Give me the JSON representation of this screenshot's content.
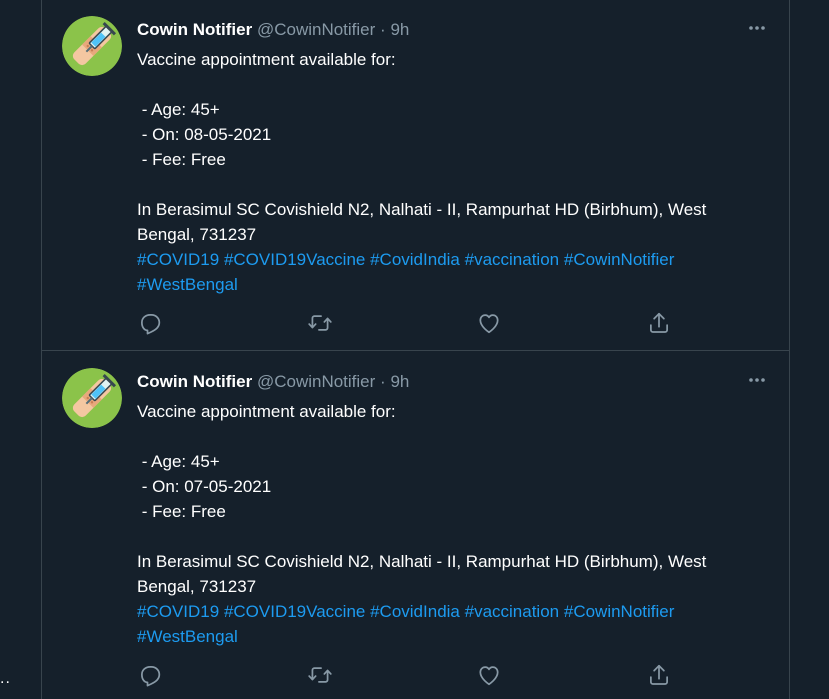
{
  "left_fragment": "..",
  "tweets": [
    {
      "name": "Cowin Notifier",
      "handle": "@CowinNotifier",
      "separator": "·",
      "time": "9h",
      "body": {
        "line1": "Vaccine appointment available for:",
        "line2": " - Age: 45+",
        "line3": " - On: 08-05-2021",
        "line4": " - Fee: Free",
        "line5": "In Berasimul SC Covishield N2, Nalhati - II, Rampurhat HD (Birbhum), West",
        "line6": "Bengal, 731237"
      },
      "hashtags": [
        "#COVID19",
        "#COVID19Vaccine",
        "#CovidIndia",
        "#vaccination",
        "#CowinNotifier",
        "#WestBengal"
      ],
      "icons": {
        "avatar": "syringe-bandage-avatar",
        "more": "more-options-icon",
        "reply": "reply-icon",
        "retweet": "retweet-icon",
        "like": "like-icon",
        "share": "share-icon"
      }
    },
    {
      "name": "Cowin Notifier",
      "handle": "@CowinNotifier",
      "separator": "·",
      "time": "9h",
      "body": {
        "line1": "Vaccine appointment available for:",
        "line2": " - Age: 45+",
        "line3": " - On: 07-05-2021",
        "line4": " - Fee: Free",
        "line5": "In Berasimul SC Covishield N2, Nalhati - II, Rampurhat HD (Birbhum), West",
        "line6": "Bengal, 731237"
      },
      "hashtags": [
        "#COVID19",
        "#COVID19Vaccine",
        "#CovidIndia",
        "#vaccination",
        "#CowinNotifier",
        "#WestBengal"
      ],
      "icons": {
        "avatar": "syringe-bandage-avatar",
        "more": "more-options-icon",
        "reply": "reply-icon",
        "retweet": "retweet-icon",
        "like": "like-icon",
        "share": "share-icon"
      }
    }
  ],
  "colors": {
    "background": "#15202b",
    "border": "#38444d",
    "text": "#ffffff",
    "muted": "#8899a6",
    "link": "#1d9bf0",
    "avatar_bg": "#8bc34a"
  }
}
